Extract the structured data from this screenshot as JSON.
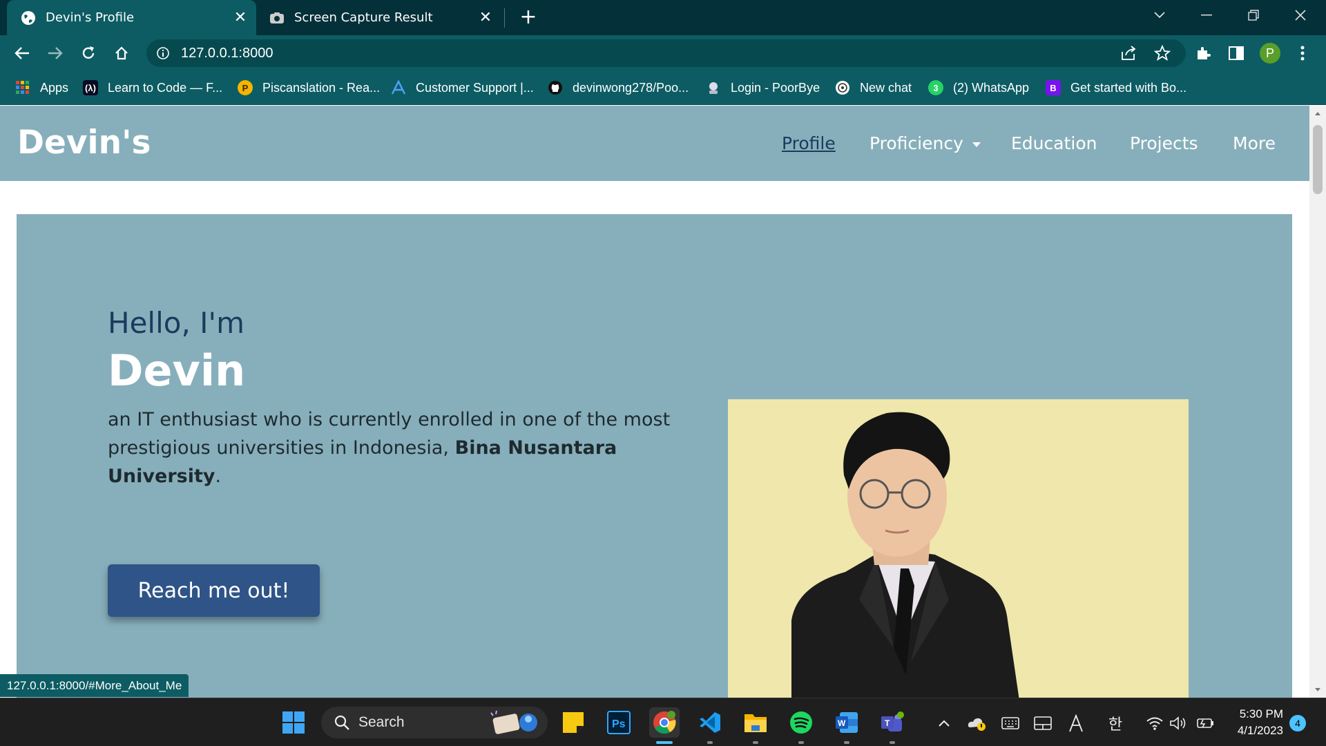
{
  "browser": {
    "tabs": [
      {
        "title": "Devin's Profile",
        "active": true,
        "icon": "globe-icon"
      },
      {
        "title": "Screen Capture Result",
        "active": false,
        "icon": "camera-icon"
      }
    ],
    "url": "127.0.0.1:8000",
    "profile_initial": "P",
    "bookmarks": [
      {
        "label": "Apps",
        "icon": "apps-grid-icon"
      },
      {
        "label": "Learn to Code — F...",
        "icon": "freecodecamp-icon"
      },
      {
        "label": "Piscanslation - Rea...",
        "icon": "piscanslation-icon"
      },
      {
        "label": "Customer Support |...",
        "icon": "support-icon"
      },
      {
        "label": "devinwong278/Poo...",
        "icon": "github-icon"
      },
      {
        "label": "Login - PoorBye",
        "icon": "poorbye-icon"
      },
      {
        "label": "New chat",
        "icon": "chatgpt-icon"
      },
      {
        "label": "(2) WhatsApp",
        "icon": "whatsapp-icon"
      },
      {
        "label": "Get started with Bo...",
        "icon": "bootstrap-icon"
      }
    ],
    "status_url": "127.0.0.1:8000/#More_About_Me"
  },
  "site": {
    "brand": "Devin's",
    "nav": [
      {
        "label": "Profile",
        "active": true
      },
      {
        "label": "Proficiency",
        "dropdown": true
      },
      {
        "label": "Education"
      },
      {
        "label": "Projects"
      },
      {
        "label": "More"
      }
    ],
    "hero": {
      "greeting": "Hello, I'm",
      "name": "Devin",
      "desc_prefix": "an IT enthusiast who is currently enrolled in one of the most prestigious universities in Indonesia, ",
      "desc_bold": "Bina Nusantara University",
      "desc_suffix": ".",
      "cta": "Reach me out!"
    }
  },
  "taskbar": {
    "search_label": "Search",
    "apps": [
      "windows-start-icon",
      "sticky-notes-icon",
      "photoshop-icon",
      "chrome-icon",
      "vscode-icon",
      "file-explorer-icon",
      "spotify-icon",
      "word-icon",
      "teams-icon"
    ],
    "time": "5:30 PM",
    "date": "4/1/2023",
    "notifications": "4",
    "ime_label": "한"
  },
  "colors": {
    "tabstrip": "#043039",
    "toolbar": "#0d5c63",
    "navbar": "#87afbb",
    "hero": "#87afbb",
    "cta": "#2f5487",
    "photo_bg": "#efe7ab"
  }
}
